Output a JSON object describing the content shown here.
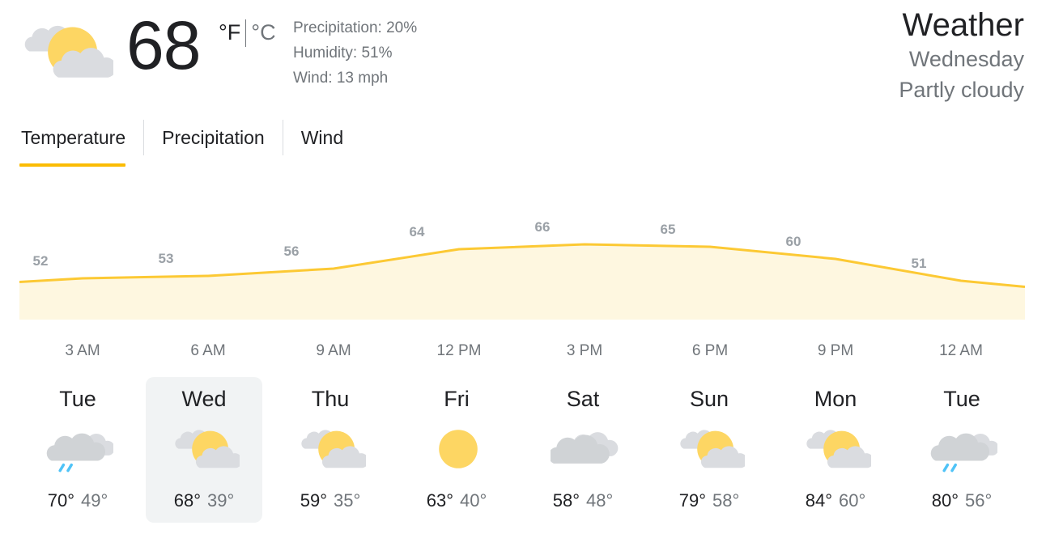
{
  "current": {
    "icon": "partly-cloudy-icon",
    "temperature": "68",
    "unit_f": "°F",
    "unit_c": "°C",
    "precipitation": "Precipitation: 20%",
    "humidity": "Humidity: 51%",
    "wind": "Wind: 13 mph"
  },
  "header": {
    "title": "Weather",
    "day": "Wednesday",
    "condition": "Partly cloudy"
  },
  "tabs": [
    {
      "label": "Temperature",
      "active": true
    },
    {
      "label": "Precipitation",
      "active": false
    },
    {
      "label": "Wind",
      "active": false
    }
  ],
  "colors": {
    "accent": "#fbbc04",
    "line": "#fcc934",
    "fill": "#fef7e0",
    "sun": "#fdd663",
    "cloud": "#dadce0",
    "rain": "#4fc3f7",
    "muted": "#70757a",
    "selected_bg": "#f1f3f4"
  },
  "chart_data": {
    "type": "area",
    "x": [
      "3 AM",
      "6 AM",
      "9 AM",
      "12 PM",
      "3 PM",
      "6 PM",
      "9 PM",
      "12 AM"
    ],
    "values": [
      52,
      53,
      56,
      64,
      66,
      65,
      60,
      51
    ],
    "labels": [
      "52",
      "53",
      "56",
      "64",
      "66",
      "65",
      "60",
      "51"
    ]
  },
  "forecast": [
    {
      "day": "Tue",
      "high": "70°",
      "low": "49°",
      "icon": "rain-icon",
      "selected": false
    },
    {
      "day": "Wed",
      "high": "68°",
      "low": "39°",
      "icon": "partly-cloudy-icon",
      "selected": true
    },
    {
      "day": "Thu",
      "high": "59°",
      "low": "35°",
      "icon": "partly-cloudy-icon",
      "selected": false
    },
    {
      "day": "Fri",
      "high": "63°",
      "low": "40°",
      "icon": "sunny-icon",
      "selected": false
    },
    {
      "day": "Sat",
      "high": "58°",
      "low": "48°",
      "icon": "cloudy-icon",
      "selected": false
    },
    {
      "day": "Sun",
      "high": "79°",
      "low": "58°",
      "icon": "partly-cloudy-icon",
      "selected": false
    },
    {
      "day": "Mon",
      "high": "84°",
      "low": "60°",
      "icon": "partly-cloudy-icon",
      "selected": false
    },
    {
      "day": "Tue",
      "high": "80°",
      "low": "56°",
      "icon": "rain-icon",
      "selected": false
    }
  ]
}
